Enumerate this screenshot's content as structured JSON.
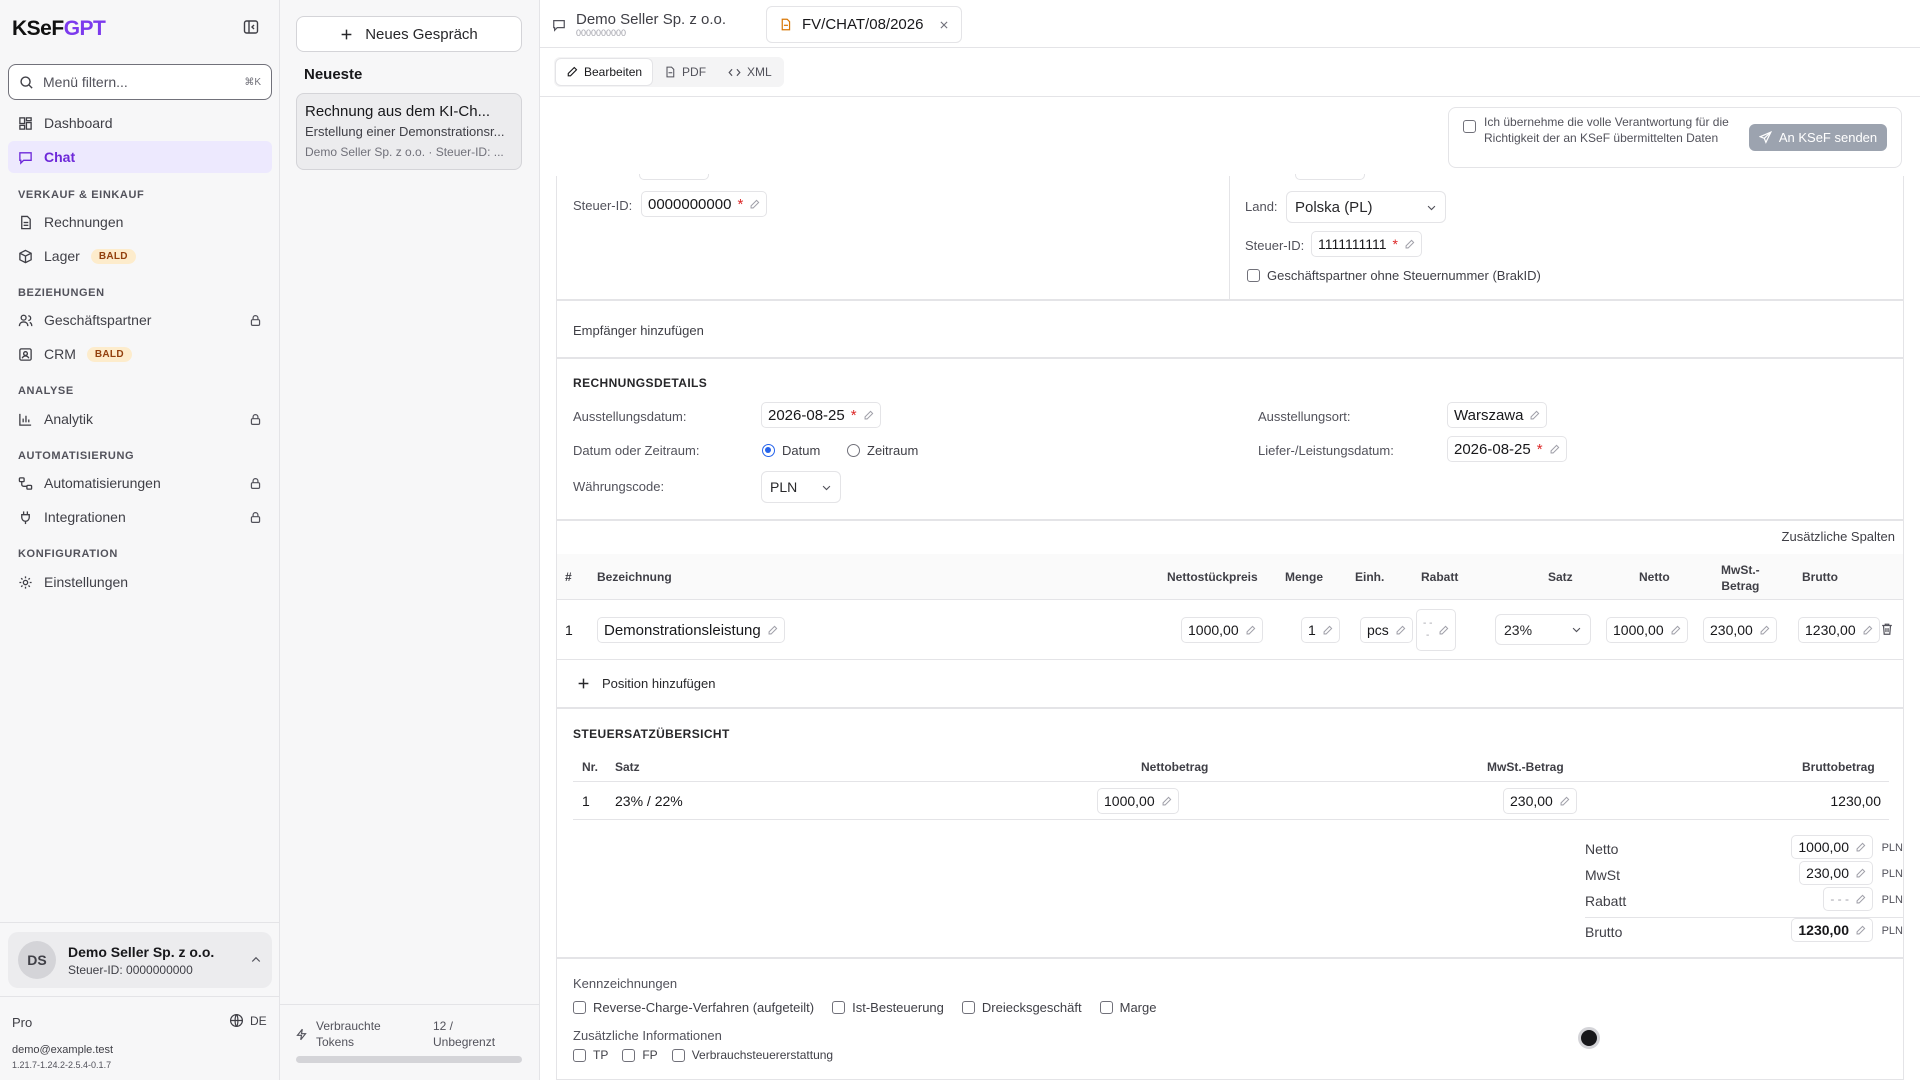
{
  "brand": {
    "logo_a": "KSeF",
    "logo_b": "GPT"
  },
  "sidebar": {
    "filter_placeholder": "Menü filtern...",
    "filter_shortcut": "⌘K",
    "items": [
      {
        "label": "Dashboard",
        "icon": "dashboard-icon"
      },
      {
        "label": "Chat",
        "icon": "chat-icon",
        "active": true
      }
    ],
    "sections": [
      {
        "title": "VERKAUF & EINKAUF",
        "items": [
          {
            "label": "Rechnungen"
          },
          {
            "label": "Lager",
            "badge": "BALD"
          }
        ]
      },
      {
        "title": "BEZIEHUNGEN",
        "items": [
          {
            "label": "Geschäftspartner",
            "locked": true
          },
          {
            "label": "CRM",
            "badge": "BALD"
          }
        ]
      },
      {
        "title": "ANALYSE",
        "items": [
          {
            "label": "Analytik",
            "locked": true
          }
        ]
      },
      {
        "title": "AUTOMATISIERUNG",
        "items": [
          {
            "label": "Automatisierungen",
            "locked": true
          },
          {
            "label": "Integrationen",
            "locked": true
          }
        ]
      },
      {
        "title": "KONFIGURATION",
        "items": [
          {
            "label": "Einstellungen"
          }
        ]
      }
    ],
    "account": {
      "initials": "DS",
      "name": "Demo Seller Sp. z o.o.",
      "tax": "Steuer-ID: 0000000000"
    },
    "plan": "Pro",
    "lang": "DE",
    "email": "demo@example.test",
    "version": "1.21.7-1.24.2-2.5.4-0.1.7"
  },
  "chats": {
    "new_label": "Neues Gespräch",
    "recent_title": "Neueste",
    "card": {
      "title": "Rechnung aus dem KI-Ch...",
      "subtitle": "Erstellung einer Demonstrationsr...",
      "meta": "Demo Seller Sp. z o.o. · Steuer-ID: ..."
    },
    "tokens_label_1": "Verbrauchte",
    "tokens_label_2": "Tokens",
    "tokens_value_1": "12 /",
    "tokens_value_2": "Unbegrenzt"
  },
  "tabs": [
    {
      "title": "Demo Seller Sp. z o.o.",
      "sub": "0000000000"
    },
    {
      "title": "FV/CHAT/08/2026"
    }
  ],
  "modes": [
    "Bearbeiten",
    "PDF",
    "XML"
  ],
  "send": {
    "consent": "Ich übernehme die volle Verantwortung für die Richtigkeit der an KSeF übermittelten Daten",
    "button": "An KSeF senden"
  },
  "seller": {
    "tax_label": "Steuer-ID:",
    "tax_value": "0000000000"
  },
  "buyer": {
    "country_label": "Land:",
    "country_value": "Polska (PL)",
    "tax_label": "Steuer-ID:",
    "tax_value": "1111111111",
    "nokey_label": "Geschäftspartner ohne Steuernummer (BrakID)"
  },
  "add_recipient": "Empfänger hinzufügen",
  "details": {
    "title": "RECHNUNGSDETAILS",
    "issue_date_label": "Ausstellungsdatum:",
    "issue_date": "2026-08-25",
    "place_label": "Ausstellungsort:",
    "place": "Warszawa",
    "period_label": "Datum oder Zeitraum:",
    "opt_date": "Datum",
    "opt_period": "Zeitraum",
    "delivery_label": "Liefer-/Leistungsdatum:",
    "delivery_date": "2026-08-25",
    "currency_label": "Währungscode:",
    "currency": "PLN"
  },
  "extra_cols": "Zusätzliche Spalten",
  "items_table": {
    "headers": {
      "nr": "#",
      "name": "Bezeichnung",
      "unit_price": "Nettostückpreis",
      "qty": "Menge",
      "unit": "Einh.",
      "discount": "Rabatt",
      "rate": "Satz",
      "net": "Netto",
      "vat_1": "MwSt.-",
      "vat_2": "Betrag",
      "gross": "Brutto"
    },
    "rows": [
      {
        "nr": "1",
        "name": "Demonstrationsleistung",
        "unit_price": "1000,00",
        "qty": "1",
        "unit": "pcs",
        "discount": "- -\n-",
        "rate": "23%",
        "net": "1000,00",
        "vat": "230,00",
        "gross": "1230,00"
      }
    ],
    "add_label": "Position hinzufügen"
  },
  "tax_summary": {
    "title": "STEUERSATZÜBERSICHT",
    "headers": {
      "nr": "Nr.",
      "rate": "Satz",
      "net": "Nettobetrag",
      "vat": "MwSt.-Betrag",
      "gross": "Bruttobetrag"
    },
    "rows": [
      {
        "nr": "1",
        "rate": "23% / 22%",
        "net": "1000,00",
        "vat": "230,00",
        "gross": "1230,00"
      }
    ]
  },
  "totals": [
    {
      "label": "Netto",
      "value": "1000,00",
      "cur": "PLN"
    },
    {
      "label": "MwSt",
      "value": "230,00",
      "cur": "PLN"
    },
    {
      "label": "Rabatt",
      "value": "- - -",
      "cur": "PLN"
    },
    {
      "label": "Brutto",
      "value": "1230,00",
      "cur": "PLN"
    }
  ],
  "flags": {
    "title": "Kennzeichnungen",
    "items": [
      "Reverse-Charge-Verfahren (aufgeteilt)",
      "Ist-Besteuerung",
      "Dreiecksgeschäft",
      "Marge"
    ],
    "extra_title": "Zusätzliche Informationen",
    "extra_items": [
      "TP",
      "FP",
      "Verbrauchsteuererstattung"
    ]
  },
  "colors": {
    "accent": "#6d28d9",
    "active_bg": "#ede9fe",
    "badge_bg": "#fdeccc",
    "send_btn": "#9ca3af"
  }
}
